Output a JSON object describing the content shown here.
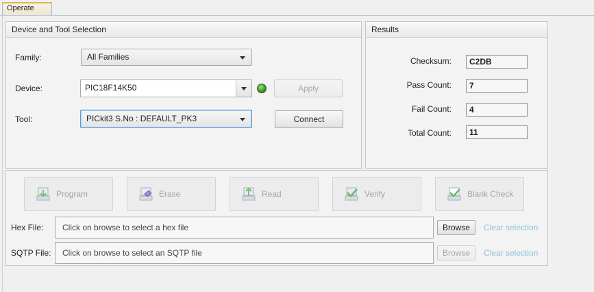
{
  "tabs": [
    {
      "label": "Operate"
    }
  ],
  "device_panel": {
    "title": "Device and Tool Selection",
    "family_label": "Family:",
    "family_value": "All Families",
    "device_label": "Device:",
    "device_value": "PIC18F14K50",
    "tool_label": "Tool:",
    "tool_value": "PICkit3 S.No : DEFAULT_PK3",
    "apply_label": "Apply",
    "connect_label": "Connect",
    "status_color": "#3e9a2a"
  },
  "results_panel": {
    "title": "Results",
    "rows": [
      {
        "label": "Checksum:",
        "value": "C2DB"
      },
      {
        "label": "Pass Count:",
        "value": "7"
      },
      {
        "label": "Fail Count:",
        "value": "4"
      },
      {
        "label": "Total Count:",
        "value": "11"
      }
    ]
  },
  "operations": {
    "buttons": [
      {
        "label": "Program",
        "icon": "program-icon"
      },
      {
        "label": "Erase",
        "icon": "erase-icon"
      },
      {
        "label": "Read",
        "icon": "read-icon"
      },
      {
        "label": "Verify",
        "icon": "verify-icon"
      },
      {
        "label": "Blank Check",
        "icon": "blank-check-icon"
      }
    ],
    "hex_label": "Hex File:",
    "hex_placeholder": "Click on browse to select a hex file",
    "sqtp_label": "SQTP File:",
    "sqtp_placeholder": "Click on browse to select an SQTP file",
    "browse_label": "Browse",
    "clear_label": "Clear selection"
  }
}
